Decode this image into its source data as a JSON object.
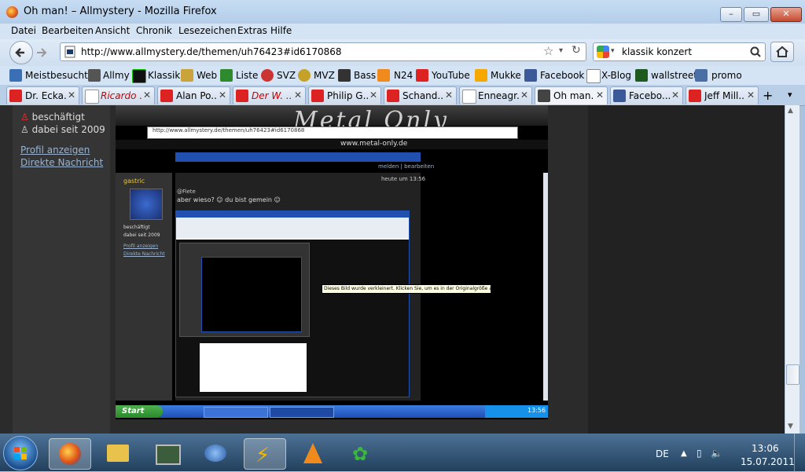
{
  "window": {
    "title": "Oh man! – Allmystery - Mozilla Firefox"
  },
  "menu": [
    "Datei",
    "Bearbeiten",
    "Ansicht",
    "Chronik",
    "Lesezeichen",
    "Extras",
    "Hilfe"
  ],
  "nav": {
    "url": "http://www.allmystery.de/themen/uh76423#id6170868",
    "search_query": "klassik konzert"
  },
  "bookmarks": [
    {
      "label": "Meistbesucht",
      "icon": "bookmark-icon"
    },
    {
      "label": "Allmy",
      "icon": "person-icon"
    },
    {
      "label": "Klassik",
      "icon": "music-icon"
    },
    {
      "label": "Web",
      "icon": "temple-icon"
    },
    {
      "label": "Liste",
      "icon": "frog-icon"
    },
    {
      "label": "SVZ",
      "icon": "sun-icon"
    },
    {
      "label": "MVZ",
      "icon": "sun-icon"
    },
    {
      "label": "Bass",
      "icon": "ukb-icon"
    },
    {
      "label": "N24",
      "icon": "orange-square-icon"
    },
    {
      "label": "YouTube",
      "icon": "youtube-icon"
    },
    {
      "label": "Mukke",
      "icon": "yellow-square-icon"
    },
    {
      "label": "Facebook",
      "icon": "facebook-icon"
    },
    {
      "label": "X-Blog",
      "icon": "page-icon"
    },
    {
      "label": "wallstreet",
      "icon": "mo-icon"
    },
    {
      "label": "promo",
      "icon": "pb-icon"
    }
  ],
  "tabs": [
    {
      "label": "Dr. Ecka...",
      "icon": "youtube-icon"
    },
    {
      "label": "Ricardo ...",
      "icon": "page-icon"
    },
    {
      "label": "Alan Po...",
      "icon": "youtube-icon"
    },
    {
      "label": "Der W. ...",
      "icon": "youtube-icon"
    },
    {
      "label": "Philip G...",
      "icon": "youtube-icon"
    },
    {
      "label": "Schand...",
      "icon": "youtube-icon"
    },
    {
      "label": "Enneagr...",
      "icon": "page-icon"
    },
    {
      "label": "Oh man...",
      "icon": "allmy-icon"
    },
    {
      "label": "Facebo...",
      "icon": "facebook-icon"
    },
    {
      "label": "Jeff Mill...",
      "icon": "youtube-icon"
    }
  ],
  "profile": {
    "status": "beschäftigt",
    "since": "dabei seit 2009",
    "link_profile": "Profil anzeigen",
    "link_message": "Direkte Nachricht"
  },
  "embedded": {
    "banner_text": "Metal Only",
    "banner_url": "www.metal-only.de",
    "inner_url": "http://www.allmystery.de/themen/uh76423#id6170868",
    "links": "melden | bearbeiten",
    "username": "gastric",
    "timestamp": "heute um 13:56",
    "post_ref": "@Fiete",
    "post_text": "aber wieso? ☺ du bist gemein ☺",
    "user_status": "beschäftigt",
    "user_since": "dabei seit 2009",
    "user_link1": "Profil anzeigen",
    "user_link2": "Direkte Nachricht",
    "notice": "Dieses Bild wurde verkleinert. Klicken Sie, um es in der Originalgröße anzuzeigen.",
    "xp_start": "Start",
    "xp_time": "13:56"
  },
  "taskbar": {
    "lang": "DE",
    "time": "13:06",
    "date": "15.07.2011"
  }
}
